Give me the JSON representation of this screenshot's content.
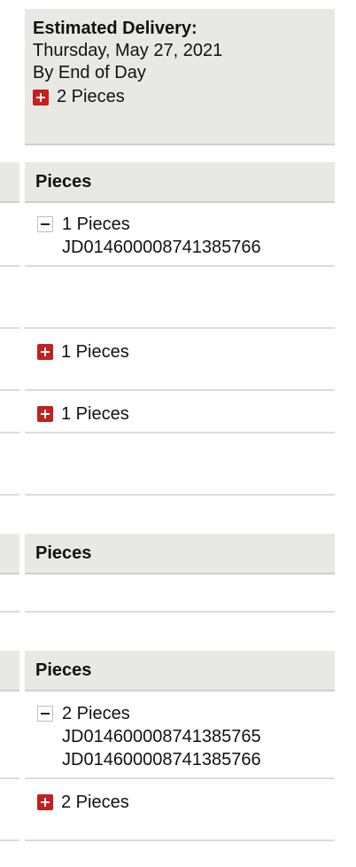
{
  "estimated_delivery": {
    "title": "Estimated Delivery:",
    "date": "Thursday, May 27, 2021",
    "time": "By End of Day",
    "pieces": "2 Pieces"
  },
  "sections": [
    {
      "header": "Pieces",
      "rows": [
        {
          "pieces": "1 Pieces",
          "expanded": true,
          "tracking": [
            "JD014600008741385766"
          ]
        },
        {
          "pieces": "1 Pieces",
          "expanded": false
        },
        {
          "pieces": "1 Pieces",
          "expanded": false
        }
      ]
    },
    {
      "header": "Pieces",
      "rows": []
    },
    {
      "header": "Pieces",
      "rows": [
        {
          "pieces": "2 Pieces",
          "expanded": true,
          "tracking": [
            "JD014600008741385765",
            "JD014600008741385766"
          ]
        },
        {
          "pieces": "2 Pieces",
          "expanded": false
        }
      ]
    }
  ],
  "icons": {
    "expand": "plus-icon",
    "collapse": "minus-icon"
  },
  "colors": {
    "expand_icon_bg": "#c2211f",
    "header_bg": "#e8e8e4"
  }
}
